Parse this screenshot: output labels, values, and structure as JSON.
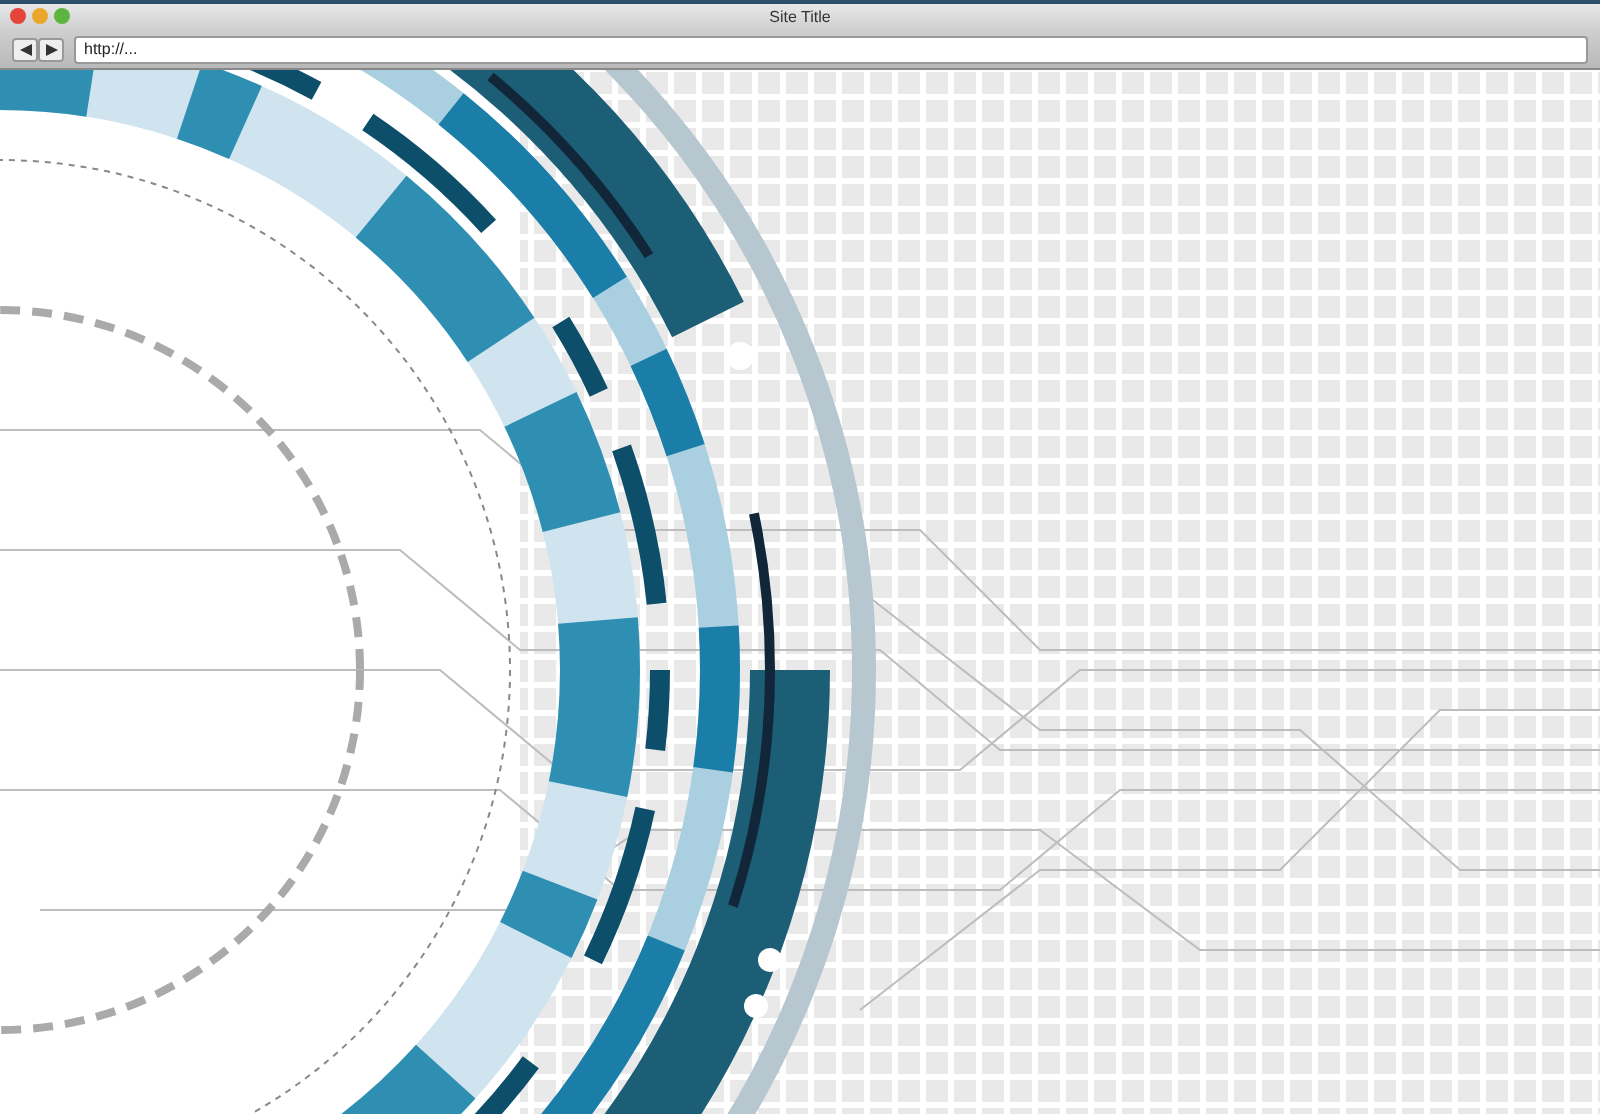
{
  "window": {
    "title": "Site Title"
  },
  "address_bar": {
    "value": "http://..."
  }
}
